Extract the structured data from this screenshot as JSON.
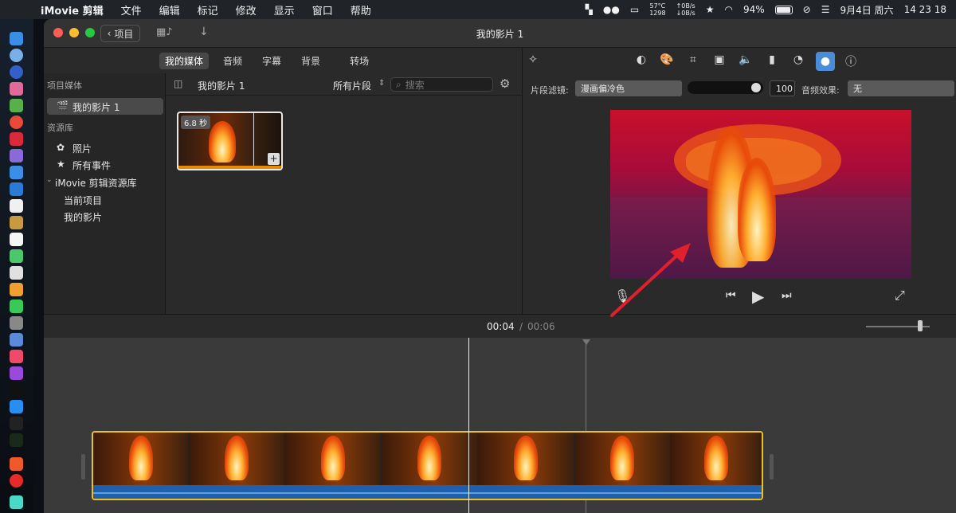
{
  "menubar": {
    "app": "iMovie 剪辑",
    "items": [
      "文件",
      "编辑",
      "标记",
      "修改",
      "显示",
      "窗口",
      "帮助"
    ],
    "temp": "57°C",
    "rpm": "1298",
    "net_up": "↑0B/s",
    "net_down": "↓0B/s",
    "battery": "94%",
    "date": "9月4日 周六",
    "time": "14 23 18"
  },
  "window": {
    "title": "我的影片 1",
    "back_label": "项目"
  },
  "media_tabs": [
    "我的媒体",
    "音频",
    "字幕",
    "背景",
    "转场"
  ],
  "sidebar": {
    "section_project": "项目媒体",
    "project_item": "我的影片 1",
    "section_library": "资源库",
    "photos": "照片",
    "all_events": "所有事件",
    "library_name": "iMovie 剪辑资源库",
    "current_project": "当前项目",
    "my_movie": "我的影片"
  },
  "browser": {
    "title": "我的影片 1",
    "filter": "所有片段",
    "search_placeholder": "搜索",
    "clip_duration": "6.8 秒"
  },
  "inspector": {
    "clip_filter_label": "片段滤镜:",
    "clip_filter_value": "漫画偏冷色",
    "slider_value": "100",
    "audio_effect_label": "音频效果:",
    "audio_effect_value": "无",
    "active_tool": "color-filter-icon"
  },
  "timeline": {
    "current_time": "00:04",
    "separator": "/",
    "total_time": "00:06"
  },
  "colors": {
    "clip_border": "#f0c020",
    "audio_track": "#1e5fae",
    "active_tool": "#4a8cd8",
    "annotation_arrow": "#e0202a"
  }
}
